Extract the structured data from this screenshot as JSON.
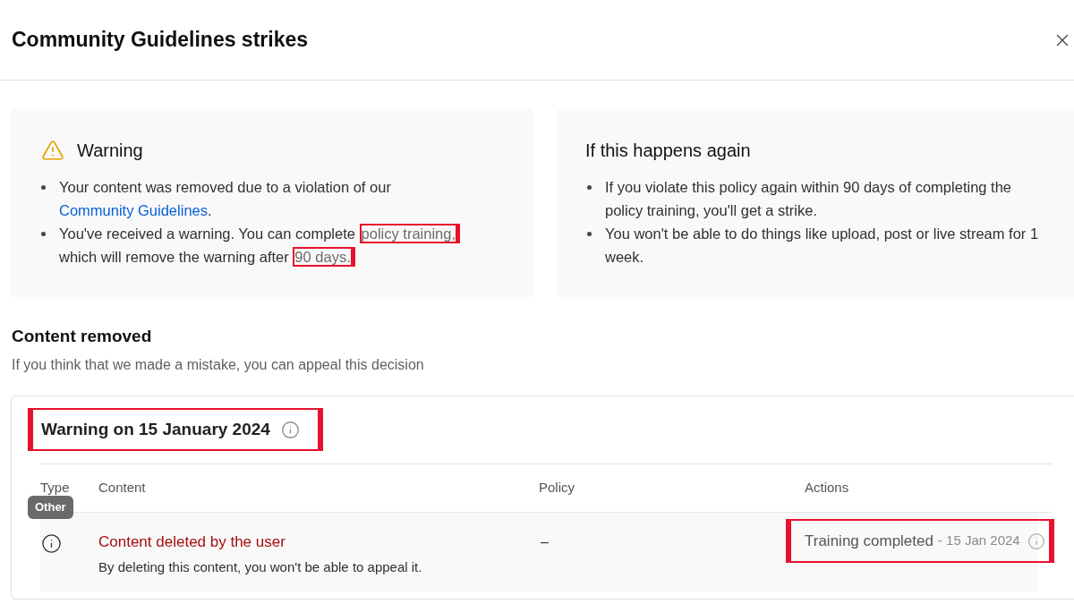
{
  "dialog": {
    "title": "Community Guidelines strikes"
  },
  "summary_cards": [
    {
      "kind": "warning",
      "title": "Warning",
      "bullets": [
        [
          {
            "kind": "text",
            "text": "Your content was removed due to a violation of our "
          },
          {
            "kind": "link",
            "text": "Community Guidelines"
          },
          {
            "kind": "text",
            "text": "."
          }
        ],
        [
          {
            "kind": "text",
            "text": "You've received a warning. You can complete "
          },
          {
            "kind": "highlight",
            "text": "policy training,"
          },
          {
            "kind": "text",
            "text": " which will remove the warning after "
          },
          {
            "kind": "highlight",
            "text": "90 days."
          }
        ]
      ]
    },
    {
      "kind": "notice",
      "title": "If this happens again",
      "bullets": [
        [
          {
            "kind": "text",
            "text": "If you violate this policy again within 90 days of completing the policy training, you'll get a strike."
          }
        ],
        [
          {
            "kind": "text",
            "text": "You won't be able to do things like upload, post or live stream for 1 week."
          }
        ]
      ]
    }
  ],
  "content_removed": {
    "title": "Content removed",
    "subtitle": "If you think that we made a mistake, you can appeal this decision"
  },
  "strike_table": {
    "heading": "Warning on 15 January 2024",
    "heading_highlighted": true,
    "columns": [
      "Type",
      "Content",
      "Policy",
      "Actions"
    ],
    "type_tooltip": "Other",
    "rows": [
      {
        "title": "Content deleted by the user",
        "note": "By deleting this content, you won't be able to appeal it.",
        "policy": "–",
        "action": "Training completed",
        "action_date": "- 15 Jan 2024",
        "action_highlighted": true
      }
    ]
  }
}
